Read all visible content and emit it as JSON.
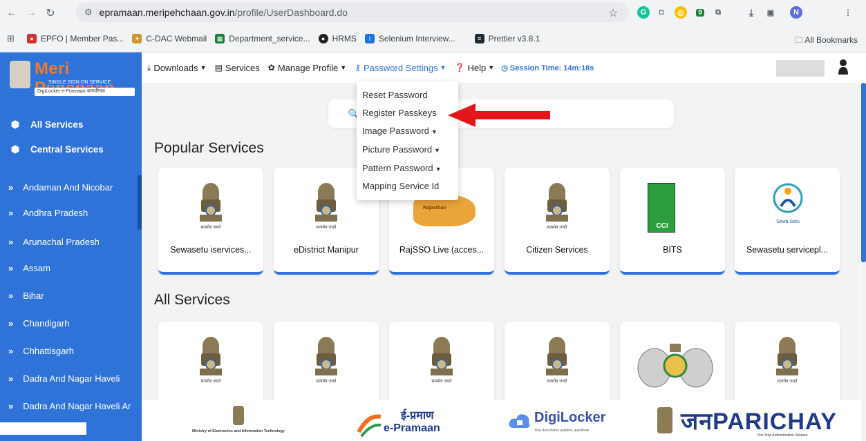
{
  "browser": {
    "url_host": "epramaan.meripehchaan.gov.in",
    "url_path": "/profile/UserDashboard.do",
    "badge_count": "9",
    "profile_initial": "N",
    "bookmarks": [
      {
        "label": "EPFO | Member Pas...",
        "icon": "epfo-icon",
        "color": "#d32f2f"
      },
      {
        "label": "C-DAC Webmail",
        "icon": "cdac-icon",
        "color": "#c79a2a"
      },
      {
        "label": "Department_service...",
        "icon": "sheets-icon",
        "color": "#188038"
      },
      {
        "label": "HRMS",
        "icon": "github-icon",
        "color": "#222222"
      },
      {
        "label": "Selenium Interview...",
        "icon": "selenium-icon",
        "color": "#1a73e8"
      },
      {
        "label": "Prettier v3.8.1",
        "icon": "prettier-icon",
        "color": "#1a2b34"
      }
    ],
    "all_bookmarks": "All Bookmarks"
  },
  "brand": {
    "title": "Meri Pehchaan",
    "subtitle": "SINGLE SIGN-ON SERVICE",
    "strip": "DigiLocker  e-Pramaan  जनपरिचय"
  },
  "sidebar": {
    "top_items": [
      "All Services",
      "Central Services"
    ],
    "states": [
      "Andaman And Nicobar",
      "Andhra Pradesh",
      "Arunachal Pradesh",
      "Assam",
      "Bihar",
      "Chandigarh",
      "Chhattisgarh",
      "Dadra And Nagar Haveli",
      "Dadra And Nagar Haveli Ar"
    ]
  },
  "topnav": {
    "downloads": "Downloads",
    "services": "Services",
    "manage_profile": "Manage Profile",
    "password_settings": "Password Settings",
    "help": "Help",
    "session_time": "Session Time:  14m:18s"
  },
  "dropdown": {
    "items": [
      {
        "label": "Reset Password",
        "has_caret": false
      },
      {
        "label": "Register Passkeys",
        "has_caret": false
      },
      {
        "label": "Image Password",
        "has_caret": true
      },
      {
        "label": "Picture Password",
        "has_caret": true
      },
      {
        "label": "Pattern Password",
        "has_caret": true
      },
      {
        "label": "Mapping Service Id",
        "has_caret": false
      }
    ]
  },
  "sections": {
    "popular": "Popular Services",
    "all": "All Services"
  },
  "popular_services": [
    "Sewasetu iservices...",
    "eDistrict Manipur",
    "RajSSO Live (acces...",
    "Citizen Services",
    "BITS",
    "Sewasetu servicepl..."
  ],
  "logos": {
    "emblem_text": "सत्यमेव जयते",
    "rajasthan": "Rajasthan",
    "cci": "CCI",
    "sewa": "Sewa Setu"
  },
  "footer": {
    "meity": "Ministry of Electronics and Information Technology",
    "epramaan_hi": "ई-प्रमाण",
    "epramaan_en": "e-Pramaan",
    "digilocker": "DigiLocker",
    "digilocker_tag": "Your documents anytime, anywhere",
    "janparichay": "जनPARICHAY",
    "janparichay_tag": "One Stop Authentication Solution"
  },
  "colors": {
    "primary": "#2f72d8",
    "brand_orange": "#f47c20",
    "arrow": "#e3161b"
  }
}
